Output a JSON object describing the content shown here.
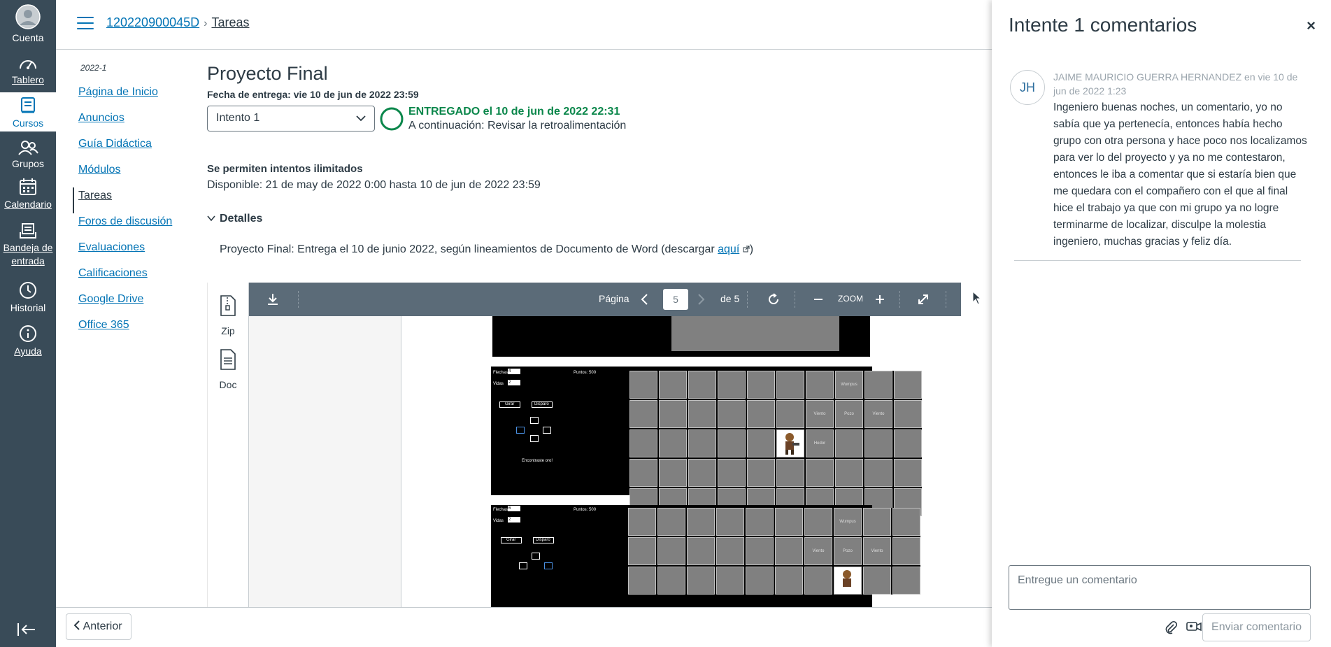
{
  "global_nav": {
    "account": "Cuenta",
    "dashboard": "Tablero",
    "courses": "Cursos",
    "groups": "Grupos",
    "calendar": "Calendario",
    "inbox_line1": "Bandeja de",
    "inbox_line2": "entrada",
    "history": "Historial",
    "help": "Ayuda",
    "active_color": "#0374b5",
    "bg_color": "#394b58"
  },
  "header": {
    "course_code": "120220900045D",
    "current": "Tareas"
  },
  "course_nav": {
    "term": "2022-1",
    "items": [
      "Página de Inicio",
      "Anuncios",
      "Guía Didáctica",
      "Módulos",
      "Tareas",
      "Foros de discusión",
      "Evaluaciones",
      "Calificaciones",
      "Google Drive",
      "Office 365"
    ]
  },
  "assignment": {
    "title": "Proyecto Final",
    "due_label": "Fecha de entrega:",
    "due_value": "vie 10 de jun de 2022 23:59",
    "attempt_select": "Intento 1",
    "status_submitted": "ENTREGADO el 10 de jun de 2022 22:31",
    "status_next": "A continuación: Revisar la retroalimentación",
    "attempts_heading": "Se permiten intentos ilimitados",
    "available": "Disponible: 21 de may de 2022 0:00 hasta 10 de jun de 2022 23:59",
    "details_label": "Detalles",
    "description": "Proyecto Final: Entrega el 10 de junio 2022, según lineamientos de Documento de Word (descargar ",
    "description_link": "aquí",
    "description_end": ")"
  },
  "viewer": {
    "file_zip": "Zip",
    "file_doc": "Doc",
    "page_label": "Página",
    "page_value": "5",
    "page_of": "de 5",
    "zoom_label": "ZOOM",
    "game1": {
      "flechas": "Flechas",
      "flechas_val": "4",
      "vidas": "Vidas",
      "vidas_val": "2",
      "puntos": "Puntos: 500",
      "girar": "Girar",
      "disparo": "Disparo",
      "found": "Encontraste oro!",
      "wumpus": "Wumpus",
      "viento": "Viento",
      "pozo": "Pozo",
      "hedor": "Hedor"
    },
    "game2": {
      "flechas_val": "6",
      "vidas_val": "2"
    }
  },
  "bottom": {
    "prev": "Anterior"
  },
  "comments": {
    "title": "Intente 1 comentarios",
    "close": "×",
    "avatar": "JH",
    "author_meta": "JAIME MAURICIO GUERRA HERNANDEZ en vie 10 de jun de 2022 1:23",
    "text": "Ingeniero buenas noches, un comentario, yo no sabía que ya pertenecía, entonces había hecho grupo con otra persona y hace poco nos localizamos para ver lo del proyecto y ya no me contestaron, entonces le iba a comentar que si estaría bien que me quedara con el compañero con el que al final hice el trabajo ya que con mi grupo ya no logre terminarme de localizar, disculpe la molestia ingeniero, muchas gracias y feliz día.",
    "input_placeholder": "Entregue un comentario",
    "send": "Enviar comentario"
  }
}
